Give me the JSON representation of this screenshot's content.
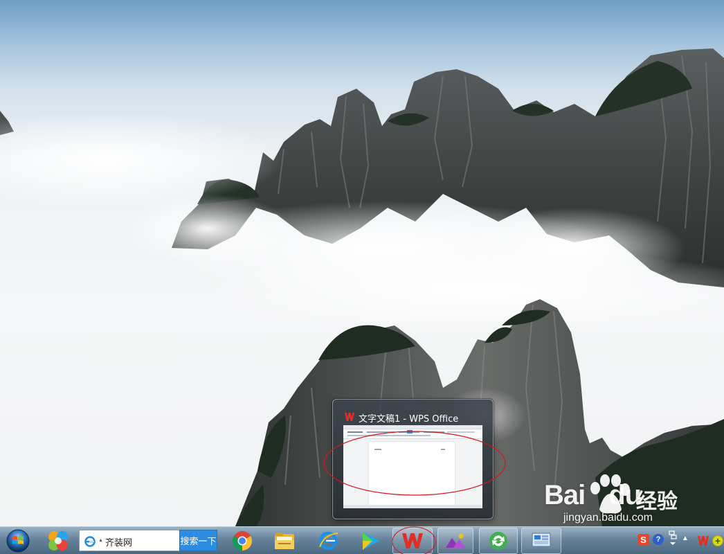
{
  "taskbar": {
    "start_button": "Start",
    "address_bar": {
      "value": "齐装网"
    },
    "search_button": "搜索一下",
    "apps": [
      {
        "name": "chrome-icon"
      },
      {
        "name": "file-explorer-icon"
      },
      {
        "name": "internet-explorer-icon"
      },
      {
        "name": "media-player-icon"
      },
      {
        "name": "wps-office-icon",
        "active": true
      },
      {
        "name": "photo-app-icon"
      },
      {
        "name": "refresh-app-icon"
      },
      {
        "name": "control-panel-icon"
      }
    ],
    "tray": [
      {
        "name": "sogou-input-icon",
        "label": "S"
      },
      {
        "name": "help-icon",
        "label": "?"
      },
      {
        "name": "network-icon"
      },
      {
        "name": "tray-expand-icon",
        "label": "▲"
      },
      {
        "name": "wps-tray-icon"
      },
      {
        "name": "green-tray-icon",
        "label": "+"
      }
    ]
  },
  "preview": {
    "title": "文字文稿1 - WPS Office"
  },
  "watermark": {
    "brand": "Bai",
    "brand2": "du",
    "jingyan": "经验",
    "url": "jingyan.baidu.com"
  },
  "colors": {
    "annotation_red": "#d9141b",
    "wps_red": "#e02f26",
    "taskbar": "#64849e"
  }
}
